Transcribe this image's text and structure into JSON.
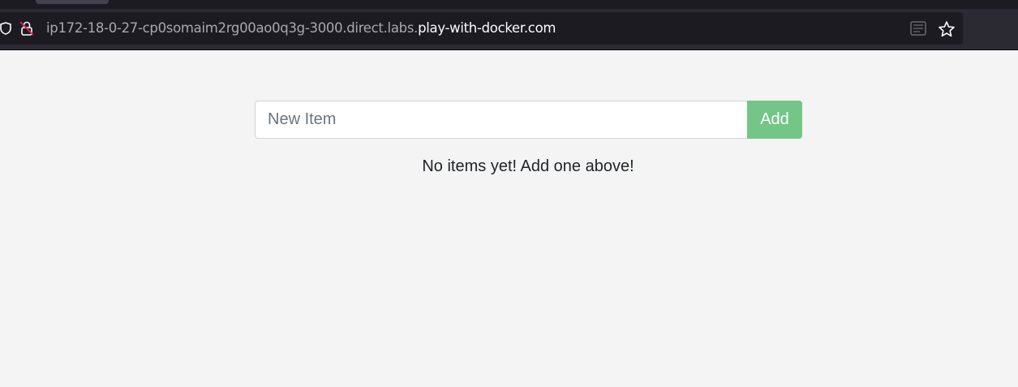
{
  "browser": {
    "url_dim": "ip172-18-0-27-cp0somaim2rg00ao0q3g-3000.direct.labs.",
    "url_bright": "play-with-docker.com",
    "icons": [
      "shield-icon",
      "lock-insecure-icon",
      "reader-view-icon",
      "bookmark-star-icon"
    ]
  },
  "app": {
    "input_placeholder": "New Item",
    "input_value": "",
    "add_label": "Add",
    "empty_message": "No items yet! Add one above!"
  },
  "colors": {
    "add_button": "#73c686",
    "page_background": "#f4f4f4",
    "toolbar": "#2b2a33",
    "urlbar": "#1c1b22"
  }
}
